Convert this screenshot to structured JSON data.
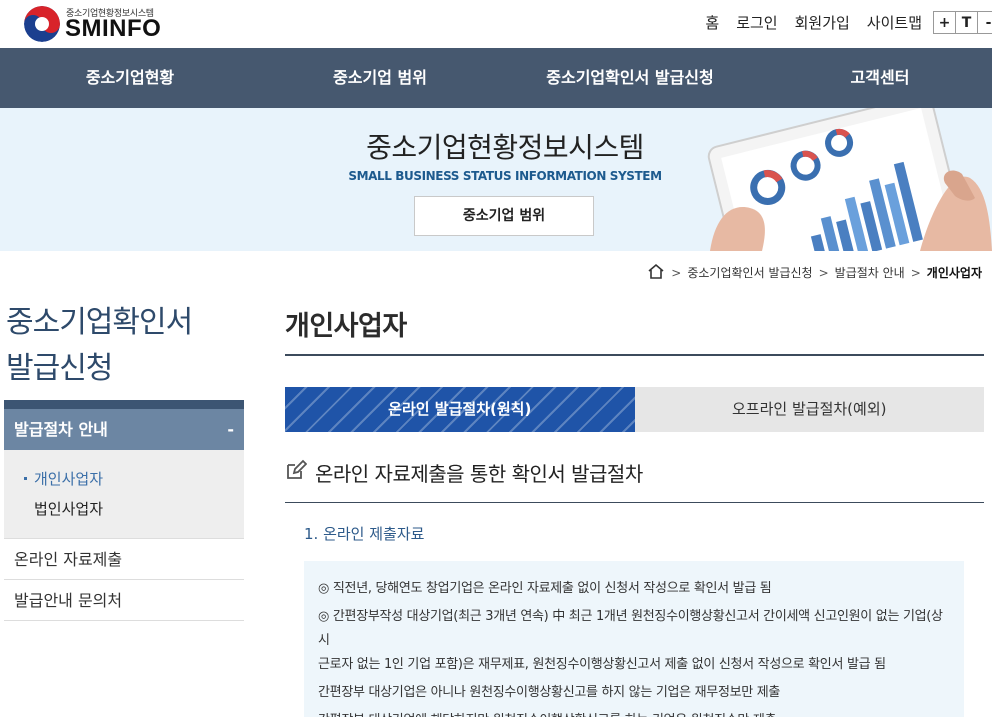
{
  "header": {
    "logo_sub": "중소기업현황정보시스템",
    "logo_main": "SMINFO",
    "util_links": [
      "홈",
      "로그인",
      "회원가입",
      "사이트맵"
    ],
    "font_buttons": [
      "+",
      "T",
      "-"
    ]
  },
  "gnb": {
    "items": [
      "중소기업현황",
      "중소기업 범위",
      "중소기업확인서 발급신청",
      "고객센터"
    ]
  },
  "banner": {
    "title": "중소기업현황정보시스템",
    "subtitle": "SMALL BUSINESS STATUS INFORMATION SYSTEM",
    "button": "중소기업 범위"
  },
  "breadcrumb": {
    "items": [
      "중소기업확인서 발급신청",
      "발급절차 안내",
      "개인사업자"
    ],
    "separator": ">"
  },
  "lnb": {
    "title_line1": "중소기업확인서",
    "title_line2": "발급신청",
    "active": "발급절차 안내",
    "active_toggle": "-",
    "sub_items": [
      "개인사업자",
      "법인사업자"
    ],
    "items": [
      "온라인 자료제출",
      "발급안내 문의처"
    ]
  },
  "main": {
    "page_title": "개인사업자",
    "tabs": [
      "온라인 발급절차(원칙)",
      "오프라인 발급절차(예외)"
    ],
    "section_title": "온라인 자료제출을 통한 확인서 발급절차",
    "sub_title": "1. 온라인 제출자료",
    "info_lines": [
      "◎ 직전년, 당해연도 창업기업은 온라인 자료제출 없이 신청서 작성으로 확인서 발급 됨",
      "◎ 간편장부작성 대상기업(최근 3개년 연속) 中 최근 1개년 원천징수이행상황신고서 간이세액 신고인원이 없는 기업(상시",
      "근로자 없는 1인 기업 포함)은 재무제표, 원천징수이행상황신고서 제출 없이 신청서 작성으로 확인서 발급 됨",
      "간편장부 대상기업은 아니나 원천징수이행상황신고를 하지 않는 기업은 재무정보만 제출",
      "간편장부 대상기업에 해당하지만 원천징수이행상황신고를 하는 기업은 원천징수만 제출"
    ]
  },
  "colors": {
    "gnb_bg": "#46586f",
    "banner_bg": "#e8f3fb",
    "tab_active": "#1f54a8",
    "lnb_active": "#6c86a3",
    "info_bg": "#eef6fb"
  }
}
